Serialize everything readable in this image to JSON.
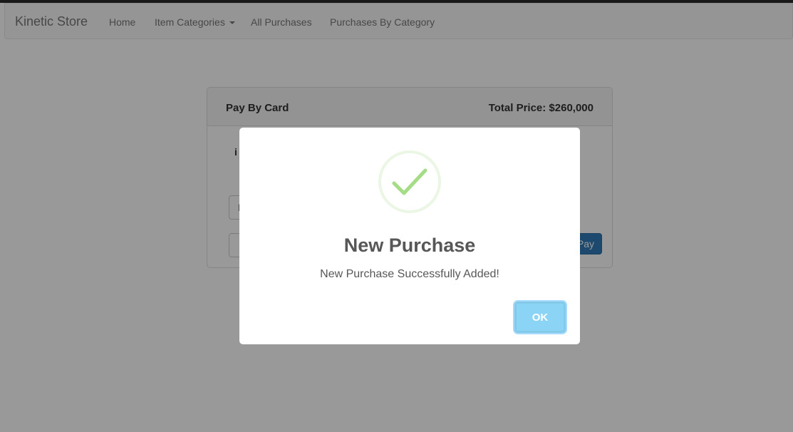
{
  "navbar": {
    "brand": "Kinetic Store",
    "links": [
      {
        "label": "Home"
      },
      {
        "label": "Item Categories"
      },
      {
        "label": "All Purchases"
      },
      {
        "label": "Purchases By Category"
      }
    ]
  },
  "card": {
    "title": "Pay By Card",
    "total": "Total Price: $260,000",
    "item_fragment": "i",
    "input1_fragment": "E",
    "input2_fragment": "",
    "pay_label": "Pay"
  },
  "modal": {
    "icon": "success-check-icon",
    "title": "New Purchase",
    "message": "New Purchase Successfully Added!",
    "ok_label": "OK"
  },
  "colors": {
    "pay_button": "#337ab7",
    "ok_button": "#8cd4f5",
    "check": "#a5dc86"
  }
}
